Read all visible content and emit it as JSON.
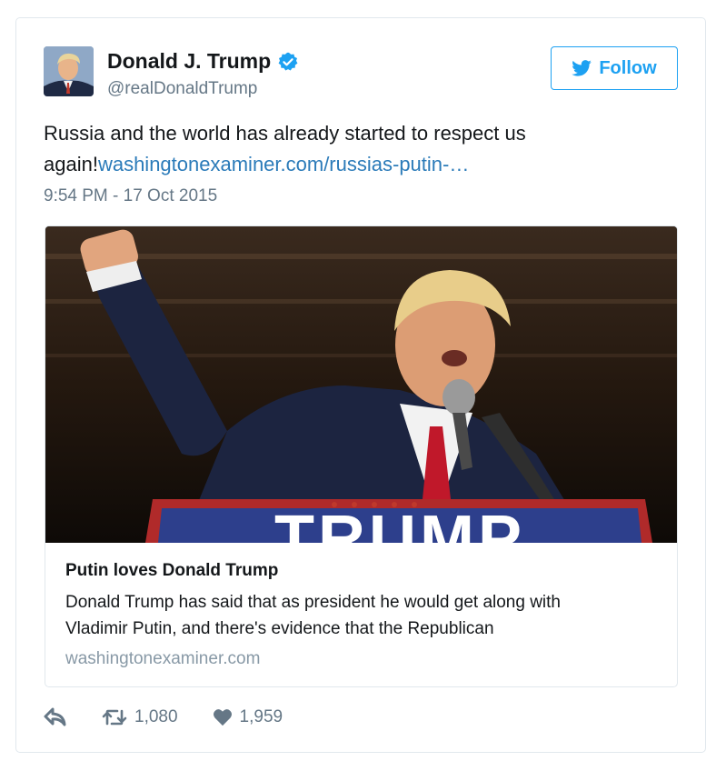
{
  "user": {
    "display_name": "Donald J. Trump",
    "handle": "@realDonaldTrump",
    "verified": true,
    "avatar_icon": "profile-photo"
  },
  "follow_button": {
    "label": "Follow",
    "icon": "twitter-bird-icon"
  },
  "tweet": {
    "text": "Russia and the world has already started to respect us again!",
    "link_text": "washingtonexaminer.com/russias-putin-…",
    "timestamp": "9:54 PM - 17 Oct 2015"
  },
  "card": {
    "image": "photo of speaker pointing at a podium microphone",
    "podium_text": "TRUMP",
    "title": "Putin loves Donald Trump",
    "description_line1": "Donald Trump has said that as president he would get along with",
    "description_line2": "Vladimir Putin, and there's evidence that the Republican",
    "domain": "washingtonexaminer.com"
  },
  "actions": {
    "reply_icon": "reply-icon",
    "retweet_icon": "retweet-icon",
    "retweet_count": "1,080",
    "like_icon": "heart-icon",
    "like_count": "1,959"
  },
  "colors": {
    "twitter_blue": "#1da1f2",
    "link_blue": "#2b7bb9",
    "secondary_text": "#657786",
    "border": "#e1e8ed"
  }
}
